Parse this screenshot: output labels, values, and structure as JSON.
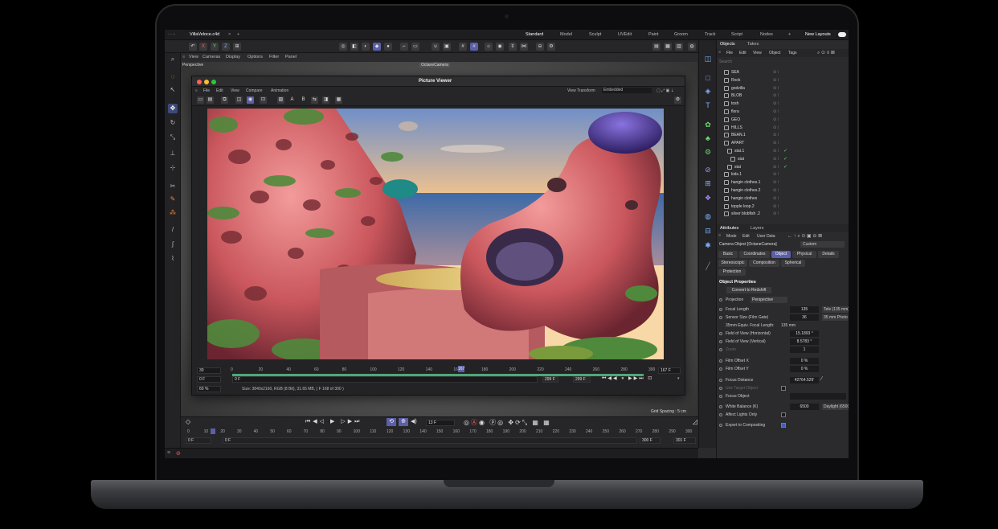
{
  "file_tab": "VillaVeloce.c4d",
  "workspaces": [
    "Standard",
    "Model",
    "Sculpt",
    "UVEdit",
    "Paint",
    "Groom",
    "Track",
    "Script",
    "Nodes"
  ],
  "active_workspace": "Standard",
  "new_layouts": "New Layouts",
  "viewport": {
    "menu": [
      "View",
      "Cameras",
      "Display",
      "Options",
      "Filter",
      "Panel"
    ],
    "label": "Perspective",
    "camera_label": "OctaneCamera",
    "grid_spacing": "Grid Spacing : 5 cm"
  },
  "picture_viewer": {
    "title": "Picture Viewer",
    "menu": [
      "File",
      "Edit",
      "View",
      "Compare",
      "Animation"
    ],
    "view_transform_label": "View Transform",
    "view_transform_value": "Embedded",
    "ruler": [
      "0",
      "20",
      "40",
      "60",
      "80",
      "100",
      "120",
      "140",
      "160",
      "180",
      "200",
      "220",
      "240",
      "260",
      "280",
      "300"
    ],
    "left_val": "30",
    "start_frame": "0 F",
    "f1": "0 F",
    "f2": "299 F",
    "f3": "299 F",
    "current": "167 F",
    "marker": "167",
    "zoom": "60 %",
    "size_info": "Size: 3840x2160, RGB (8 Bit), 31.65 MB,  ( F 168 of 300 )"
  },
  "objects_panel": {
    "tabs": [
      "Objects",
      "Takes"
    ],
    "menu": [
      "File",
      "Edit",
      "View",
      "Object",
      "Tags"
    ],
    "search": "Search",
    "items": [
      "SEA",
      "Rock",
      "godzilla",
      "BLOB",
      "tosh",
      "flora",
      "GEO",
      "HILLS",
      "BEAN.1",
      "APART",
      "stat.1",
      "stat",
      "stat",
      "kids.1",
      "hangin clothes.1",
      "hangin clothes.2",
      "hangin clothes",
      "topple loop.2",
      "silver blobfish .2"
    ]
  },
  "attributes": {
    "tabs": [
      "Attributes",
      "Layers"
    ],
    "menu": [
      "Mode",
      "Edit",
      "User Data"
    ],
    "object": "Camera Object [OctaneCamera]",
    "preset": "Custom",
    "sub_tabs_1": [
      "Basic",
      "Coordinates",
      "Object",
      "Physical",
      "Details"
    ],
    "sub_tabs_2": [
      "Stereoscopic",
      "Composition",
      "Spherical"
    ],
    "sub_tabs_3": [
      "Protection"
    ],
    "section": "Object Properties",
    "convert_button": "Convert to Redshift",
    "projection_label": "Projection",
    "projection_value": "Perspective",
    "props": [
      {
        "label": "Focal Length",
        "value": "135",
        "extra": "Tele (135 mm)"
      },
      {
        "label": "Sensor Size (Film Gate)",
        "value": "36",
        "extra": "35 mm Photo"
      },
      {
        "label": "35mm Equiv. Focal Length:",
        "value": "135 mm",
        "extra": ""
      },
      {
        "label": "Field of View (Horizontal)",
        "value": "15.1893 °",
        "extra": ""
      },
      {
        "label": "Field of View (Vertical)",
        "value": "8.5783 °",
        "extra": ""
      },
      {
        "label": "Zoom",
        "value": "1",
        "extra": ""
      },
      {
        "label": "Film Offset X",
        "value": "0 %",
        "extra": ""
      },
      {
        "label": "Film Offset Y",
        "value": "0 %",
        "extra": ""
      },
      {
        "label": "Focus Distance",
        "value": "42764.529'",
        "extra": ""
      },
      {
        "label": "Use Target Object",
        "value": "",
        "extra": ""
      },
      {
        "label": "Focus Object",
        "value": "",
        "extra": ""
      },
      {
        "label": "White Balance (K)",
        "value": "6500",
        "extra": "Daylight (6500 K)"
      },
      {
        "label": "Affect Lights Only",
        "value": "",
        "extra": ""
      },
      {
        "label": "Export to Compositing",
        "value": "",
        "extra": ""
      }
    ]
  },
  "timeline": {
    "ruler": [
      "0",
      "10",
      "20",
      "30",
      "40",
      "50",
      "60",
      "70",
      "80",
      "90",
      "100",
      "110",
      "120",
      "130",
      "140",
      "150",
      "160",
      "170",
      "180",
      "190",
      "200",
      "210",
      "220",
      "230",
      "240",
      "250",
      "260",
      "270",
      "280",
      "290",
      "300"
    ],
    "frame": "13 F",
    "start": "0 F",
    "start2": "0 F",
    "end": "300 F",
    "end2": "301 F"
  }
}
